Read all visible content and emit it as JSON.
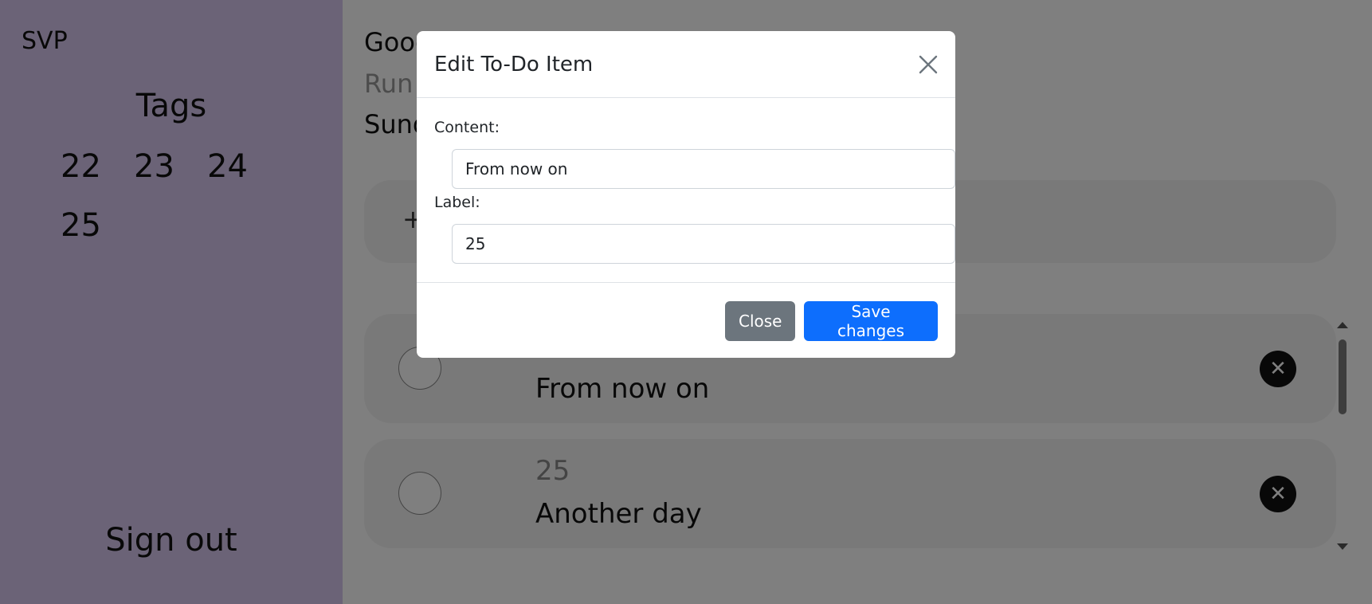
{
  "sidebar": {
    "brand": "SVP",
    "tags_title": "Tags",
    "tags": [
      "22",
      "23",
      "24",
      "25"
    ],
    "signout": "Sign out"
  },
  "main": {
    "greeting": "Good",
    "quote": "Run",
    "day": "Sund",
    "add_icon": "+",
    "items": [
      {
        "label": "",
        "content": "From now on"
      },
      {
        "label": "25",
        "content": "Another day"
      }
    ],
    "delete_icon": "✕"
  },
  "modal": {
    "title": "Edit To-Do Item",
    "content_label": "Content:",
    "content_value": "From now on",
    "label_label": "Label:",
    "label_value": "25",
    "close_button": "Close",
    "save_button": "Save changes"
  },
  "colors": {
    "sidebar_bg": "#d6c6ee",
    "primary": "#0d6efd",
    "secondary": "#6c757d"
  }
}
